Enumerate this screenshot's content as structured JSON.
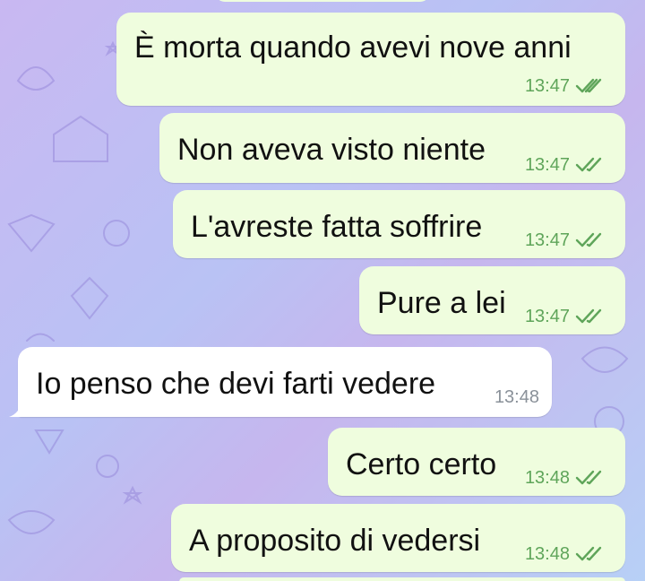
{
  "messages": [
    {
      "text": "È morta quando avevi nove anni",
      "time": "13:47",
      "direction": "outgoing",
      "read": true
    },
    {
      "text": "Non aveva visto niente",
      "time": "13:47",
      "direction": "outgoing",
      "read": true
    },
    {
      "text": "L'avreste fatta soffrire",
      "time": "13:47",
      "direction": "outgoing",
      "read": true
    },
    {
      "text": "Pure a lei",
      "time": "13:47",
      "direction": "outgoing",
      "read": true
    },
    {
      "text": "Io penso che devi farti vedere",
      "time": "13:48",
      "direction": "incoming",
      "read": false
    },
    {
      "text": "Certo certo",
      "time": "13:48",
      "direction": "outgoing",
      "read": true
    },
    {
      "text": "A proposito di vedersi",
      "time": "13:48",
      "direction": "outgoing",
      "read": true
    }
  ],
  "colors": {
    "outgoing_bubble": "#effdde",
    "incoming_bubble": "#ffffff",
    "read_check": "#5fa55a",
    "incoming_time": "#8a9199"
  },
  "icons": {
    "read_status": "double-check-icon"
  }
}
